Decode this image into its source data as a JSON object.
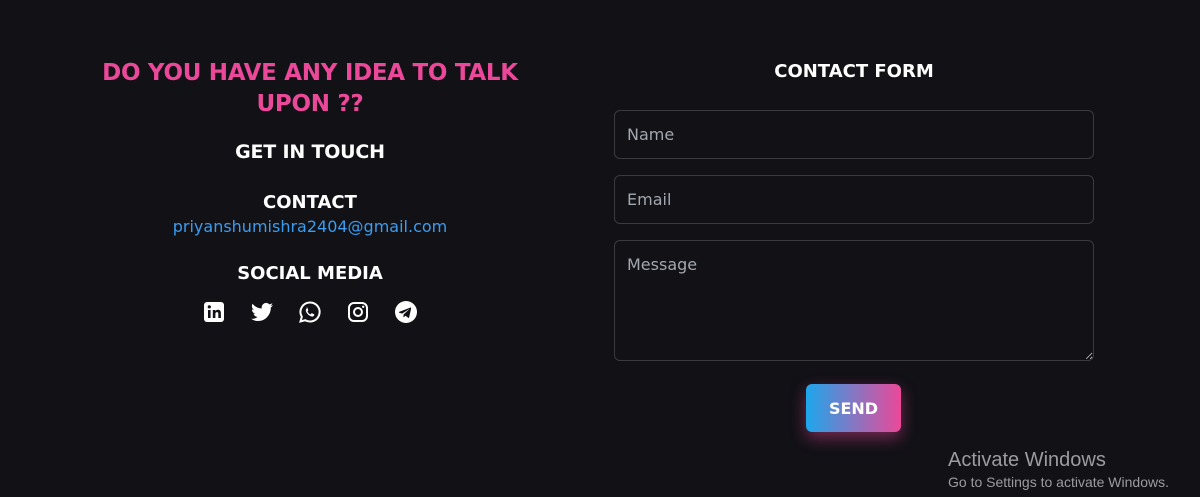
{
  "left": {
    "headline": "DO YOU HAVE ANY IDEA TO TALK UPON ??",
    "get_in_touch": "GET IN TOUCH",
    "contact_title": "CONTACT",
    "email": "priyanshumishra2404@gmail.com",
    "social_title": "SOCIAL MEDIA",
    "social_icons": [
      "linkedin-icon",
      "twitter-icon",
      "whatsapp-icon",
      "instagram-icon",
      "telegram-icon"
    ]
  },
  "form": {
    "title": "CONTACT FORM",
    "name_placeholder": "Name",
    "email_placeholder": "Email",
    "message_placeholder": "Message",
    "send_label": "SEND"
  },
  "watermark": {
    "title": "Activate Windows",
    "subtitle": "Go to Settings to activate Windows."
  },
  "colors": {
    "background": "#111116",
    "headline": "#ec4899",
    "email_link": "#3b9cf0",
    "button_gradient_start": "#1da6ec",
    "button_gradient_end": "#ec4899"
  }
}
